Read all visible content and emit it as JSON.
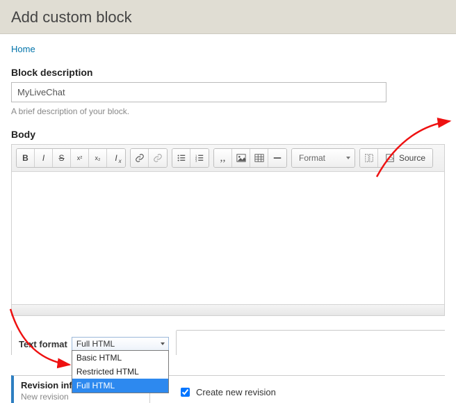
{
  "header": {
    "title": "Add custom block"
  },
  "breadcrumb": {
    "home": "Home"
  },
  "block_description": {
    "label": "Block description",
    "value": "MyLiveChat",
    "help": "A brief description of your block."
  },
  "body": {
    "label": "Body",
    "toolbar": {
      "bold": "B",
      "italic": "I",
      "strike": "S",
      "superscript": "x²",
      "subscript": "x₂",
      "removeformat": "Iₓ",
      "format_label": "Format",
      "source_label": "Source"
    }
  },
  "text_format": {
    "label": "Text format",
    "selected": "Full HTML",
    "options": [
      "Basic HTML",
      "Restricted HTML",
      "Full HTML"
    ]
  },
  "revision": {
    "tab_title": "Revision information",
    "tab_sub": "New revision",
    "checkbox_label": "Create new revision",
    "checked": true
  }
}
